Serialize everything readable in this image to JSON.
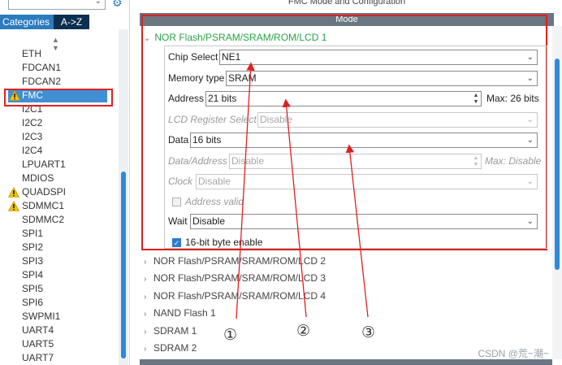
{
  "sidebar": {
    "tabs": [
      "Categories",
      "A->Z"
    ],
    "items": [
      {
        "label": "ETH",
        "warn": false,
        "selected": false
      },
      {
        "label": "FDCAN1",
        "warn": false,
        "selected": false
      },
      {
        "label": "FDCAN2",
        "warn": false,
        "selected": false
      },
      {
        "label": "FMC",
        "warn": true,
        "selected": true
      },
      {
        "label": "I2C1",
        "warn": false,
        "selected": false
      },
      {
        "label": "I2C2",
        "warn": false,
        "selected": false
      },
      {
        "label": "I2C3",
        "warn": false,
        "selected": false
      },
      {
        "label": "I2C4",
        "warn": false,
        "selected": false
      },
      {
        "label": "LPUART1",
        "warn": false,
        "selected": false
      },
      {
        "label": "MDIOS",
        "warn": false,
        "selected": false
      },
      {
        "label": "QUADSPI",
        "warn": true,
        "selected": false
      },
      {
        "label": "SDMMC1",
        "warn": true,
        "selected": false
      },
      {
        "label": "SDMMC2",
        "warn": false,
        "selected": false
      },
      {
        "label": "SPI1",
        "warn": false,
        "selected": false
      },
      {
        "label": "SPI2",
        "warn": false,
        "selected": false
      },
      {
        "label": "SPI3",
        "warn": false,
        "selected": false
      },
      {
        "label": "SPI4",
        "warn": false,
        "selected": false
      },
      {
        "label": "SPI5",
        "warn": false,
        "selected": false
      },
      {
        "label": "SPI6",
        "warn": false,
        "selected": false
      },
      {
        "label": "SWPMI1",
        "warn": false,
        "selected": false
      },
      {
        "label": "UART4",
        "warn": false,
        "selected": false
      },
      {
        "label": "UART5",
        "warn": false,
        "selected": false
      },
      {
        "label": "UART7",
        "warn": false,
        "selected": false
      }
    ]
  },
  "main": {
    "title": "FMC Mode and Configuration",
    "mode_header": "Mode",
    "expanded_section": "NOR Flash/PSRAM/SRAM/ROM/LCD 1",
    "fields": {
      "chip_select": {
        "label": "Chip Select",
        "value": "NE1"
      },
      "memory_type": {
        "label": "Memory type",
        "value": "SRAM"
      },
      "address": {
        "label": "Address",
        "value": "21 bits",
        "max": "Max: 26 bits"
      },
      "lcd_register_select": {
        "label": "LCD Register Select",
        "value": "Disable"
      },
      "data": {
        "label": "Data",
        "value": "16 bits"
      },
      "data_address": {
        "label": "Data/Address",
        "value": "Disable",
        "max": "Max: Disable"
      },
      "clock": {
        "label": "Clock",
        "value": "Disable"
      },
      "address_valid": {
        "label": "Address valid",
        "checked": false
      },
      "wait": {
        "label": "Wait",
        "value": "Disable"
      },
      "byte_enable": {
        "label": "16-bit byte enable",
        "checked": true
      }
    },
    "collapsed_sections": [
      "NOR Flash/PSRAM/SRAM/ROM/LCD 2",
      "NOR Flash/PSRAM/SRAM/ROM/LCD 3",
      "NOR Flash/PSRAM/SRAM/ROM/LCD 4",
      "NAND Flash 1",
      "SDRAM 1",
      "SDRAM 2"
    ]
  },
  "annotations": [
    "①",
    "②",
    "③"
  ],
  "watermark": "CSDN @荒~潮~",
  "colors": {
    "accent": "#2b7bbf",
    "highlight": "#e02020",
    "expanded": "#2aa24a",
    "warning": "#f2c200"
  }
}
